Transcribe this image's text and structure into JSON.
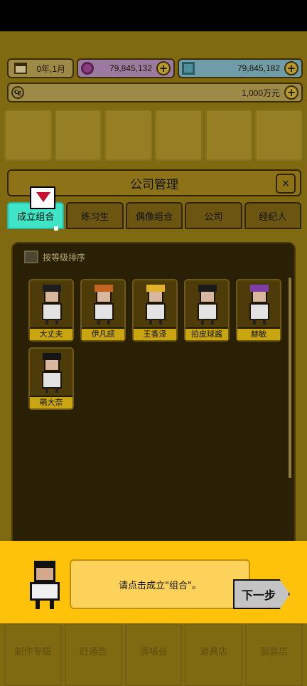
{
  "resources": {
    "date": "0年,1月",
    "gems": "79,845,132",
    "diamonds": "79,845,182",
    "money": "1,000万元"
  },
  "dialog": {
    "title": "公司管理",
    "close": "×",
    "tabs": [
      "成立组合",
      "练习生",
      "偶像组合",
      "公司",
      "经纪人"
    ],
    "sort_label": "按等级排序"
  },
  "idols": [
    {
      "name": "大丈夫",
      "hair": "#1d1d1d"
    },
    {
      "name": "伊凡颉",
      "hair": "#c2631f"
    },
    {
      "name": "王香泽",
      "hair": "#e1b12c"
    },
    {
      "name": "拍皮球酱",
      "hair": "#1a1a1a"
    },
    {
      "name": "赫敏",
      "hair": "#7d3fa6"
    },
    {
      "name": "萌大奈",
      "hair": "#151515"
    }
  ],
  "tutorial": {
    "message": "请点击成立\"组合\"。",
    "next": "下一步"
  },
  "bottom_nav": [
    "制作专辑",
    "赶通告",
    "演唱会",
    "道具店",
    "服装店"
  ]
}
